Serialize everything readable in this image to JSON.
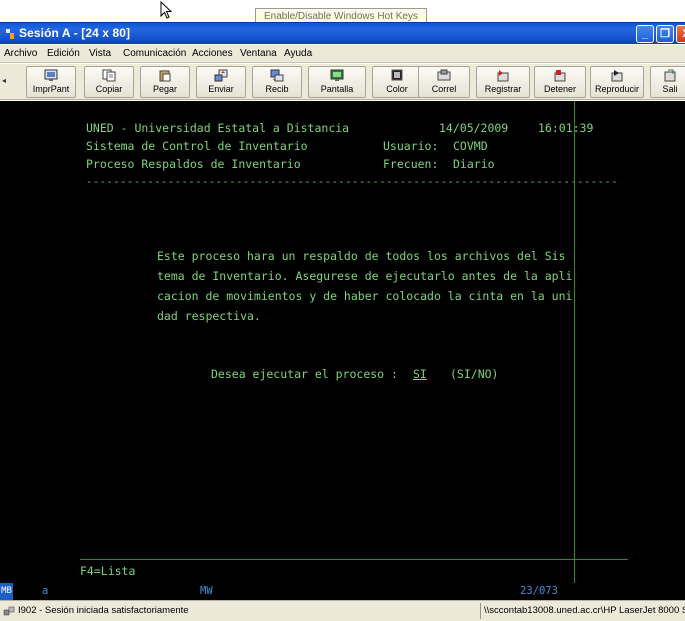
{
  "tooltip": "Enable/Disable Windows Hot Keys",
  "window": {
    "title": "Sesión A - [24 x 80]"
  },
  "menu": [
    "Archivo",
    "Edición",
    "Vista",
    "Comunicación",
    "Acciones",
    "Ventana",
    "Ayuda"
  ],
  "toolbar": [
    {
      "label": "ImprPant",
      "icon": "print-screen-icon"
    },
    {
      "label": "Copiar",
      "icon": "copy-icon"
    },
    {
      "label": "Pegar",
      "icon": "paste-icon"
    },
    {
      "label": "Enviar",
      "icon": "send-icon"
    },
    {
      "label": "Recib",
      "icon": "receive-icon"
    },
    {
      "label": "Pantalla",
      "icon": "screen-icon"
    },
    {
      "label": "Color",
      "icon": "color-icon"
    },
    {
      "label": "Correl",
      "icon": "correl-icon"
    },
    {
      "label": "Registrar",
      "icon": "record-icon"
    },
    {
      "label": "Detener",
      "icon": "stop-icon"
    },
    {
      "label": "Reproducir",
      "icon": "play-icon"
    },
    {
      "label": "Sali",
      "icon": "exit-icon"
    }
  ],
  "screen": {
    "org": "UNED - Universidad Estatal a Distancia",
    "date": "14/05/2009",
    "time": "16:01:39",
    "system": "Sistema de Control de Inventario",
    "user_label": "Usuario:",
    "user_value": "COVMD",
    "process": "Proceso Respaldos de Inventario",
    "freq_label": "Frecuen:",
    "freq_value": "Diario",
    "divider": "------------------------------------------------------------------------------",
    "message": [
      "Este proceso hara un respaldo de todos los archivos del Sis",
      "tema de Inventario. Asegurese de ejecutarlo antes de la apli",
      "cacion de movimientos y de haber colocado la cinta en la uni",
      "dad respectiva."
    ],
    "prompt": "Desea ejecutar el proceso :",
    "answer": "SI",
    "options": "(SI/NO)",
    "fkey": "F4=Lista"
  },
  "oia": {
    "mb": "MB",
    "a": "a",
    "mw": "MW",
    "cursor_pos": "23/073"
  },
  "status": {
    "message": "I902 - Sesión iniciada satisfactoriamente",
    "printer": "\\\\sccontab13008.uned.ac.cr\\HP LaserJet 8000 S"
  }
}
